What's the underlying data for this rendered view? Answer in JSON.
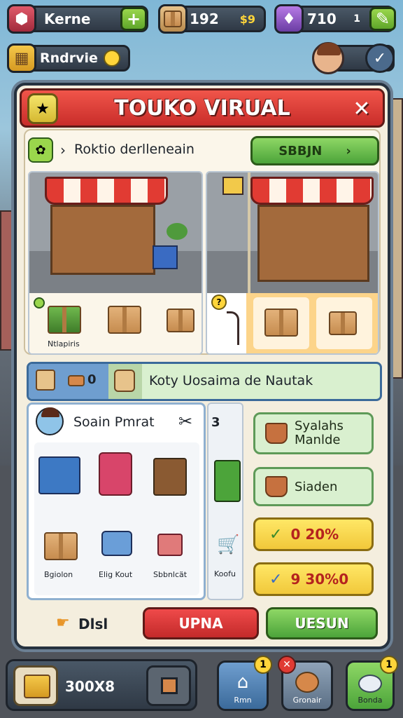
{
  "top_bar": {
    "player_name": "Kerne",
    "currency1_value": "192",
    "currency1_bonus": "$9",
    "currency2_value": "710",
    "currency2_suffix": "1",
    "secondary_label": "Rndrvie",
    "add_symbol": "+"
  },
  "panel": {
    "title": "TOUKO VIRUAL",
    "close_symbol": "✕"
  },
  "shop_section": {
    "header_text": "Roktio derlleneain",
    "header_arrow": "›",
    "button_label": "SBBJN",
    "button_arrow": "›",
    "card1_caption": "Ntlapiris",
    "card2_hook_symbol": "?"
  },
  "tabs": {
    "count": "0",
    "title": "Koty Uosaima de  Nautak"
  },
  "item_grid": {
    "heading": "Soain Pmrat",
    "items": [
      {
        "label": ""
      },
      {
        "label": ""
      },
      {
        "label": ""
      },
      {
        "label": "Bgiolon"
      },
      {
        "label": "Elig Kout"
      },
      {
        "label": "Sbbnlcät"
      }
    ],
    "side_label": "Koofu",
    "side_mark": "3"
  },
  "right_cards": {
    "card1": "Syalahs Manlde",
    "card2": "Siaden",
    "price1": "0 20%",
    "price2": "9 30%0"
  },
  "panel_footer": {
    "hint_label": "Dlsl",
    "red_button": "UPNA",
    "green_button": "UESUN"
  },
  "bottom_bar": {
    "storage_value": "300X8",
    "btn1_label": "Rmn",
    "btn1_badge": "1",
    "btn2_label": "Gronair",
    "btn3_label": "Bonda",
    "btn3_badge": "1"
  },
  "colors": {
    "header_red": "#d93a33",
    "button_green": "#5fb04a",
    "price_yellow": "#f6d64a",
    "panel_bg": "#f4eede"
  }
}
